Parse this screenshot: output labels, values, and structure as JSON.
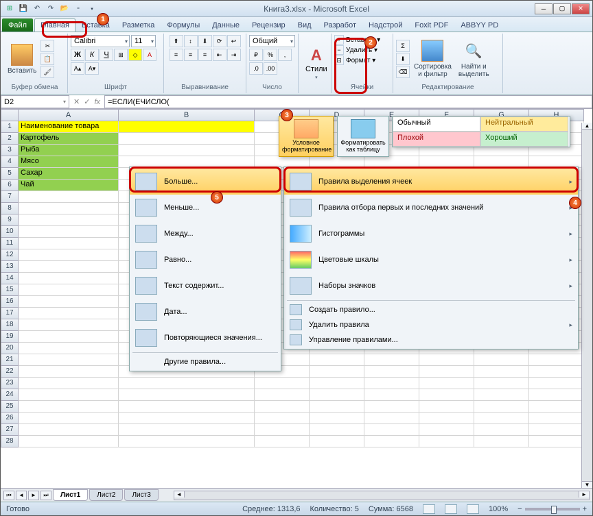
{
  "title": "Книга3.xlsx - Microsoft Excel",
  "tabs": {
    "file": "Файл",
    "home": "Главная",
    "insert": "Вставка",
    "layout": "Разметка",
    "formulas": "Формулы",
    "data": "Данные",
    "review": "Рецензир",
    "view": "Вид",
    "dev": "Разработ",
    "addins": "Надстрой",
    "foxit": "Foxit PDF",
    "abbyy": "ABBYY PD"
  },
  "ribbon": {
    "clipboard": {
      "paste": "Вставить",
      "label": "Буфер обмена"
    },
    "font": {
      "name": "Calibri",
      "size": "11",
      "label": "Шрифт"
    },
    "align": {
      "label": "Выравнивание"
    },
    "number": {
      "format": "Общий",
      "label": "Число"
    },
    "styles": {
      "btn": "Стили"
    },
    "cells": {
      "insert": "Вставить ▾",
      "delete": "Удалить ▾",
      "format": "Формат ▾",
      "label": "Ячейки"
    },
    "editing": {
      "sort": "Сортировка\nи фильтр",
      "find": "Найти и\nвыделить",
      "label": "Редактирование"
    }
  },
  "namebox": "D2",
  "formula": "=ЕСЛИ(ЕЧИСЛО(",
  "cf_btn": "Условное\nформатирование",
  "fmt_btn": "Форматировать\nкак таблицу",
  "style_gallery": {
    "normal": "Обычный",
    "neutral": "Нейтральный",
    "bad": "Плохой",
    "good": "Хороший"
  },
  "menu_rules": {
    "highlight": "Правила выделения ячеек",
    "toprules": "Правила отбора первых и последних значений",
    "databars": "Гистограммы",
    "colorscales": "Цветовые шкалы",
    "iconsets": "Наборы значков",
    "new": "Создать правило...",
    "clear": "Удалить правила",
    "manage": "Управление правилами..."
  },
  "menu_hl": {
    "greater": "Больше...",
    "less": "Меньше...",
    "between": "Между...",
    "equal": "Равно...",
    "contains": "Текст содержит...",
    "date": "Дата...",
    "dup": "Повторяющиеся значения...",
    "other": "Другие правила..."
  },
  "cols": [
    "A",
    "B",
    "C",
    "D",
    "E",
    "F",
    "G",
    "H"
  ],
  "data_rows": [
    {
      "n": "1",
      "a": "Наименование товара",
      "cls": "yellow"
    },
    {
      "n": "2",
      "a": "Картофель",
      "cls": "green"
    },
    {
      "n": "3",
      "a": "Рыба",
      "cls": "green"
    },
    {
      "n": "4",
      "a": "Мясо",
      "cls": "green"
    },
    {
      "n": "5",
      "a": "Сахар",
      "cls": "green"
    },
    {
      "n": "6",
      "a": "Чай",
      "cls": "green"
    }
  ],
  "sheets": {
    "s1": "Лист1",
    "s2": "Лист2",
    "s3": "Лист3"
  },
  "status": {
    "ready": "Готово",
    "avg": "Среднее: 1313,6",
    "count": "Количество: 5",
    "sum": "Сумма: 6568",
    "zoom": "100%"
  },
  "markers": {
    "m1": "1",
    "m2": "2",
    "m3": "3",
    "m4": "4",
    "m5": "5"
  }
}
